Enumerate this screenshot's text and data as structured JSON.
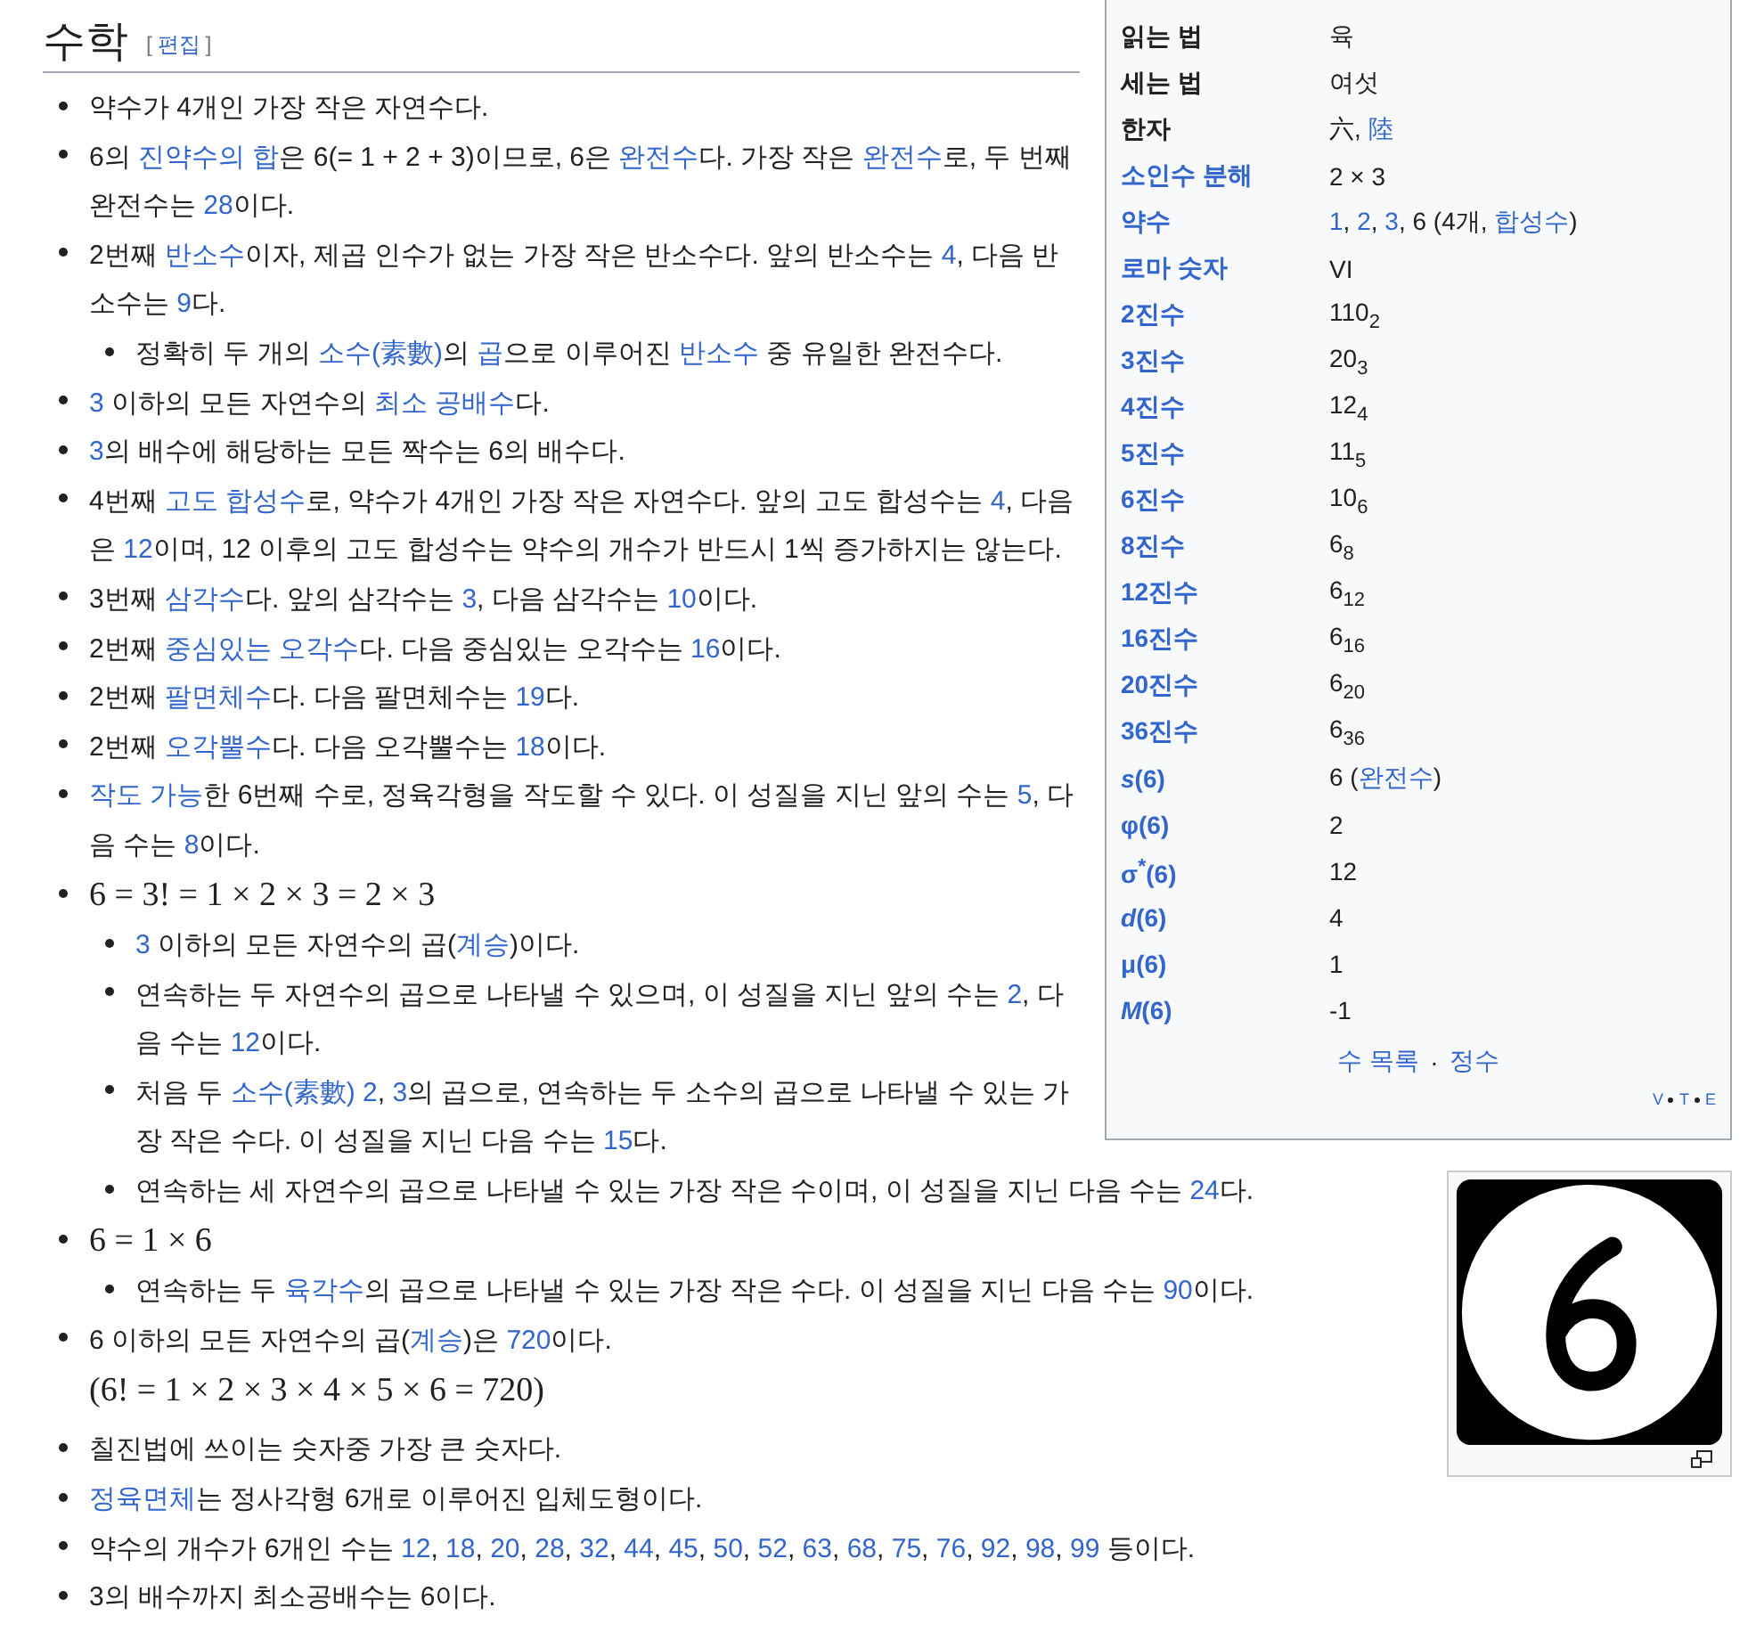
{
  "section": {
    "title": "수학",
    "edit": {
      "open": "[",
      "label": "편집",
      "close": "]"
    }
  },
  "items": [
    {
      "kind": "text",
      "parts": [
        "약수가 4개인 가장 작은 자연수다."
      ]
    },
    {
      "kind": "text",
      "parts": [
        "6의 ",
        {
          "link": "진약수의 합"
        },
        "은 6(= 1 + 2 + 3)이므로, 6은 ",
        {
          "link": "완전수"
        },
        "다. 가장 작은 ",
        {
          "link": "완전수"
        },
        "로, 두 번째 완전수는 ",
        {
          "link": "28"
        },
        "이다."
      ]
    },
    {
      "kind": "text",
      "parts": [
        "2번째 ",
        {
          "link": "반소수"
        },
        "이자, 제곱 인수가 없는 가장 작은 반소수다. 앞의 반소수는 ",
        {
          "link": "4"
        },
        ", 다음 반소수는 ",
        {
          "link": "9"
        },
        "다."
      ],
      "children": [
        {
          "kind": "text",
          "parts": [
            "정확히 두 개의 ",
            {
              "link": "소수(素數)"
            },
            "의 ",
            {
              "link": "곱"
            },
            "으로 이루어진 ",
            {
              "link": "반소수"
            },
            " 중 유일한 완전수다."
          ]
        }
      ]
    },
    {
      "kind": "text",
      "parts": [
        {
          "link": "3"
        },
        " 이하의 모든 자연수의 ",
        {
          "link": "최소 공배수"
        },
        "다."
      ]
    },
    {
      "kind": "text",
      "parts": [
        {
          "link": "3"
        },
        "의 배수에 해당하는 모든 짝수는 6의 배수다."
      ]
    },
    {
      "kind": "text",
      "parts": [
        "4번째 ",
        {
          "link": "고도 합성수"
        },
        "로, 약수가 4개인 가장 작은 자연수다. 앞의 고도 합성수는 ",
        {
          "link": "4"
        },
        ", 다음은 ",
        {
          "link": "12"
        },
        "이며, 12 이후의 고도 합성수는 약수의 개수가 반드시 1씩 증가하지는 않는다."
      ]
    },
    {
      "kind": "text",
      "parts": [
        "3번째 ",
        {
          "link": "삼각수"
        },
        "다. 앞의 삼각수는 ",
        {
          "link": "3"
        },
        ", 다음 삼각수는 ",
        {
          "link": "10"
        },
        "이다."
      ]
    },
    {
      "kind": "text",
      "parts": [
        "2번째 ",
        {
          "link": "중심있는 오각수"
        },
        "다. 다음 중심있는 오각수는 ",
        {
          "link": "16"
        },
        "이다."
      ]
    },
    {
      "kind": "text",
      "parts": [
        "2번째 ",
        {
          "link": "팔면체수"
        },
        "다. 다음 팔면체수는 ",
        {
          "link": "19"
        },
        "다."
      ]
    },
    {
      "kind": "text",
      "parts": [
        "2번째 ",
        {
          "link": "오각뿔수"
        },
        "다. 다음 오각뿔수는 ",
        {
          "link": "18"
        },
        "이다."
      ]
    },
    {
      "kind": "text",
      "parts": [
        {
          "link": "작도 가능"
        },
        "한 6번째 수로, 정육각형을 작도할 수 있다. 이 성질을 지닌 앞의 수는 ",
        {
          "link": "5"
        },
        ", 다음 수는 ",
        {
          "link": "8"
        },
        "이다."
      ]
    },
    {
      "kind": "math",
      "formula": "6 = 3! = 1 × 2 × 3 = 2 × 3",
      "children": [
        {
          "kind": "text",
          "parts": [
            {
              "link": "3"
            },
            " 이하의 모든 자연수의 곱(",
            {
              "link": "계승"
            },
            ")이다."
          ]
        },
        {
          "kind": "text",
          "parts": [
            "연속하는 두 자연수의 곱으로 나타낼 수 있으며, 이 성질을 지닌 앞의 수는 ",
            {
              "link": "2"
            },
            ", 다음 수는 ",
            {
              "link": "12"
            },
            "이다."
          ]
        },
        {
          "kind": "text",
          "parts": [
            "처음 두 ",
            {
              "link": "소수(素數)"
            },
            {
              "link": " 2"
            },
            ", ",
            {
              "link": "3"
            },
            "의 곱으로, 연속하는 두 소수의 곱으로 나타낼 수 있는 가장 작은 수다. 이 성질을 지닌 다음 수는 ",
            {
              "link": "15"
            },
            "다."
          ]
        },
        {
          "kind": "text",
          "parts": [
            "연속하는 세 자연수의 곱으로 나타낼 수 있는 가장 작은 수이며, 이 성질을 지닌 다음 수는 ",
            {
              "link": "24"
            },
            "다."
          ]
        }
      ]
    },
    {
      "kind": "math",
      "formula": "6 = 1 × 6",
      "children": [
        {
          "kind": "text",
          "parts": [
            "연속하는 두 ",
            {
              "link": "육각수"
            },
            "의 곱으로 나타낼 수 있는 가장 작은 수다. 이 성질을 지닌 다음 수는 ",
            {
              "link": "90"
            },
            "이다."
          ]
        }
      ]
    },
    {
      "kind": "text",
      "parts": [
        "6 이하의 모든 자연수의 곱(",
        {
          "link": "계승"
        },
        ")은 ",
        {
          "link": "720"
        },
        "이다."
      ],
      "formula": "(6! = 1 × 2 × 3 × 4 × 5 × 6 = 720)"
    },
    {
      "kind": "text",
      "parts": [
        "칠진법에 쓰이는 숫자중 가장 큰 숫자다."
      ]
    },
    {
      "kind": "text",
      "parts": [
        {
          "link": "정육면체"
        },
        "는 정사각형 6개로 이루어진 입체도형이다."
      ]
    },
    {
      "kind": "text",
      "parts": [
        "약수의 개수가 6개인 수는 ",
        {
          "link": "12"
        },
        ", ",
        {
          "link": "18"
        },
        ", ",
        {
          "link": "20"
        },
        ", ",
        {
          "link": "28"
        },
        ", ",
        {
          "link": "32"
        },
        ", ",
        {
          "link": "44"
        },
        ", ",
        {
          "link": "45"
        },
        ", ",
        {
          "link": "50"
        },
        ", ",
        {
          "link": "52"
        },
        ", ",
        {
          "link": "63"
        },
        ", ",
        {
          "link": "68"
        },
        ", ",
        {
          "link": "75"
        },
        ", ",
        {
          "link": "76"
        },
        ", ",
        {
          "link": "92"
        },
        ", ",
        {
          "link": "98"
        },
        ", ",
        {
          "link": "99"
        },
        " 등이다."
      ]
    },
    {
      "kind": "text",
      "parts": [
        "3의 배수까지 최소공배수는 6이다."
      ]
    }
  ],
  "infobox": {
    "rows": [
      {
        "label": "읽는 법",
        "link": false,
        "value": [
          "육"
        ]
      },
      {
        "label": "세는 법",
        "link": false,
        "value": [
          "여섯"
        ]
      },
      {
        "label": "한자",
        "link": false,
        "value": [
          "六, ",
          {
            "link": "陸"
          }
        ]
      },
      {
        "label": "소인수 분해",
        "link": true,
        "value": [
          "2 × 3"
        ]
      },
      {
        "label": "약수",
        "link": true,
        "value": [
          {
            "link": "1"
          },
          ", ",
          {
            "link": "2"
          },
          ", ",
          {
            "link": "3"
          },
          ", 6 (4개, ",
          {
            "link": "합성수"
          },
          ")"
        ]
      },
      {
        "label": "로마 숫자",
        "link": true,
        "value": [
          "VI"
        ]
      },
      {
        "label": "2진수",
        "link": true,
        "value": [
          "110$_{2}$"
        ]
      },
      {
        "label": "3진수",
        "link": true,
        "value": [
          "20$_{3}$"
        ]
      },
      {
        "label": "4진수",
        "link": true,
        "value": [
          "12$_{4}$"
        ]
      },
      {
        "label": "5진수",
        "link": true,
        "value": [
          "11$_{5}$"
        ]
      },
      {
        "label": "6진수",
        "link": true,
        "value": [
          "10$_{6}$"
        ]
      },
      {
        "label": "8진수",
        "link": true,
        "value": [
          "6$_{8}$"
        ]
      },
      {
        "label": "12진수",
        "link": true,
        "value": [
          "6$_{12}$"
        ]
      },
      {
        "label": "16진수",
        "link": true,
        "value": [
          "6$_{16}$"
        ]
      },
      {
        "label": "20진수",
        "link": true,
        "value": [
          "6$_{20}$"
        ]
      },
      {
        "label": "36진수",
        "link": true,
        "value": [
          "6$_{36}$"
        ]
      },
      {
        "label": "*s*(6)",
        "link": true,
        "value": [
          "6 (",
          {
            "link": "완전수"
          },
          ")"
        ]
      },
      {
        "label": "φ(6)",
        "link": true,
        "value": [
          "2"
        ]
      },
      {
        "label": "σ$^{*}$(6)",
        "link": true,
        "value": [
          "12"
        ]
      },
      {
        "label": "*d*(6)",
        "link": true,
        "value": [
          "4"
        ]
      },
      {
        "label": "μ(6)",
        "link": true,
        "value": [
          "1"
        ]
      },
      {
        "label": "*M*(6)",
        "link": true,
        "value": [
          "-1"
        ]
      }
    ],
    "footer": [
      {
        "link": "수 목록"
      },
      " · ",
      {
        "link": "정수"
      }
    ],
    "nav": [
      "V",
      "T",
      "E"
    ]
  }
}
